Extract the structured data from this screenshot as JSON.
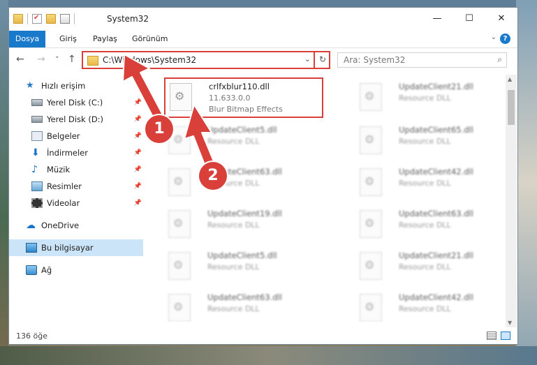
{
  "window": {
    "title": "System32",
    "controls": {
      "minimize": "—",
      "maximize": "☐",
      "close": "✕"
    }
  },
  "ribbon": {
    "tabs": [
      "Dosya",
      "Giriş",
      "Paylaş",
      "Görünüm"
    ],
    "active_tab": "Dosya",
    "help": "?"
  },
  "navigation": {
    "back": "←",
    "forward": "→",
    "recent": "˅",
    "up": "↑",
    "address": "C:\\Windows\\System32",
    "search_placeholder": "Ara: System32"
  },
  "sidebar": {
    "items": [
      {
        "label": "Hızlı erişim",
        "icon": "star-icon"
      },
      {
        "label": "Yerel Disk (C:)",
        "icon": "drive-icon",
        "pinned": true
      },
      {
        "label": "Yerel Disk (D:)",
        "icon": "drive-icon",
        "pinned": true
      },
      {
        "label": "Belgeler",
        "icon": "documents-icon",
        "pinned": true
      },
      {
        "label": "İndirmeler",
        "icon": "download-icon",
        "pinned": true
      },
      {
        "label": "Müzik",
        "icon": "music-icon",
        "pinned": true
      },
      {
        "label": "Resimler",
        "icon": "pictures-icon",
        "pinned": true
      },
      {
        "label": "Videolar",
        "icon": "videos-icon",
        "pinned": true
      },
      {
        "label": "OneDrive",
        "icon": "cloud-icon"
      },
      {
        "label": "Bu bilgisayar",
        "icon": "computer-icon",
        "selected": true
      },
      {
        "label": "Ağ",
        "icon": "network-icon"
      }
    ]
  },
  "files": [
    {
      "name": "crlfxblur110.dll",
      "line1": "11.633.0.0",
      "line2": "Blur Bitmap Effects",
      "highlighted": true
    },
    {
      "name": "UpdateClient21.dll",
      "line1": "Resource DLL"
    },
    {
      "name": "UpdateClient5.dll",
      "line1": "Resource DLL"
    },
    {
      "name": "UpdateClient65.dll",
      "line1": "Resource DLL"
    },
    {
      "name": "UpdateClient63.dll",
      "line1": "Resource DLL"
    },
    {
      "name": "UpdateClient42.dll",
      "line1": "Resource DLL"
    },
    {
      "name": "UpdateClient19.dll",
      "line1": "Resource DLL"
    },
    {
      "name": "UpdateClient63.dll",
      "line1": "Resource DLL"
    },
    {
      "name": "UpdateClient5.dll",
      "line1": "Resource DLL"
    },
    {
      "name": "UpdateClient21.dll",
      "line1": "Resource DLL"
    },
    {
      "name": "UpdateClient63.dll",
      "line1": "Resource DLL"
    },
    {
      "name": "UpdateClient42.dll",
      "line1": "Resource DLL"
    }
  ],
  "status": {
    "item_count": "136 öğe"
  },
  "callouts": [
    "1",
    "2"
  ],
  "colors": {
    "accent": "#1979ca",
    "highlight": "#d9403a"
  }
}
